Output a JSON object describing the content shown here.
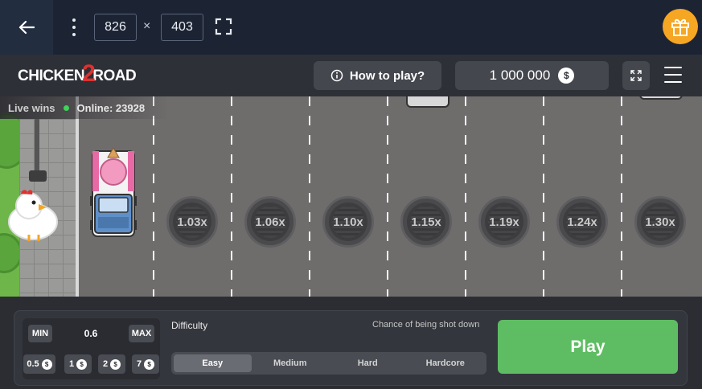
{
  "toolbar": {
    "width_value": "826",
    "times_symbol": "×",
    "height_value": "403"
  },
  "header": {
    "logo_part1": "CHICKEN",
    "logo_part2": "2",
    "logo_part3": "ROAD",
    "how_to_play": "How to play?",
    "balance": "1 000 000",
    "currency_symbol": "$"
  },
  "status": {
    "live_wins": "Live wins",
    "online": "Online: 23928"
  },
  "lanes": {
    "multipliers": [
      "1.03x",
      "1.06x",
      "1.10x",
      "1.15x",
      "1.19x",
      "1.24x",
      "1.30x"
    ]
  },
  "bet": {
    "min_label": "MIN",
    "max_label": "MAX",
    "value": "0.6",
    "quick_bets": [
      "0.5",
      "1",
      "2",
      "7"
    ]
  },
  "difficulty": {
    "label": "Difficulty",
    "chance_label": "Chance of being shot down",
    "options": [
      "Easy",
      "Medium",
      "Hard",
      "Hardcore"
    ],
    "selected": "Easy"
  },
  "play": {
    "label": "Play"
  },
  "colors": {
    "play_green": "#5ebd62",
    "road_gray": "#6f6c6c",
    "gift_orange": "#f5a623",
    "logo_red": "#e0312f"
  }
}
